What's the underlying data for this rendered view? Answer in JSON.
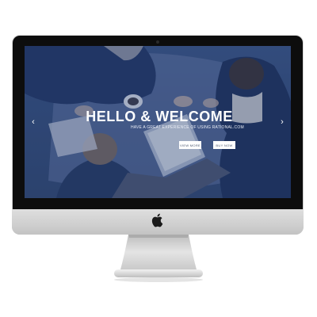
{
  "hero": {
    "title": "HELLO & WELCOME",
    "subtitle": "HAVE A GREAT EXPERIENCE OF USING RATIONAL.COM",
    "view_more_label": "VIEW MORE",
    "buy_now_label": "BUY NOW"
  },
  "carousel": {
    "prev_glyph": "‹",
    "next_glyph": "›"
  },
  "colors": {
    "screen_overlay": "#2f4b86",
    "bezel": "#0d0d0d",
    "aluminium": "#d0d0d0",
    "button_bg": "#ffffff"
  },
  "icons": {
    "brand_logo": "apple-logo",
    "prev": "chevron-left-icon",
    "next": "chevron-right-icon"
  }
}
